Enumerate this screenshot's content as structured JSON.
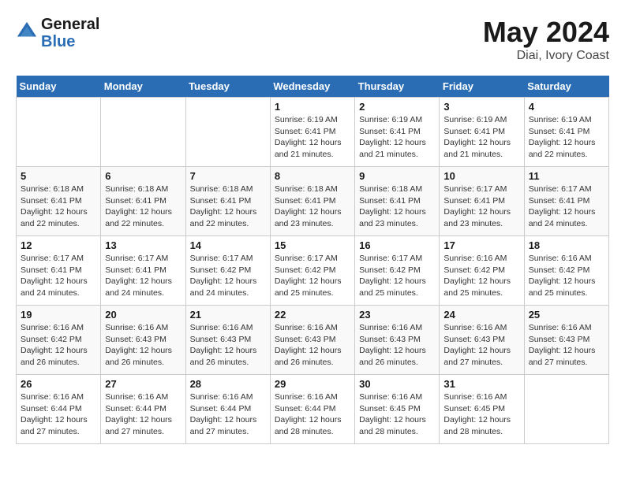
{
  "header": {
    "logo_line1": "General",
    "logo_line2": "Blue",
    "month": "May 2024",
    "location": "Diai, Ivory Coast"
  },
  "weekdays": [
    "Sunday",
    "Monday",
    "Tuesday",
    "Wednesday",
    "Thursday",
    "Friday",
    "Saturday"
  ],
  "weeks": [
    [
      {
        "day": "",
        "info": ""
      },
      {
        "day": "",
        "info": ""
      },
      {
        "day": "",
        "info": ""
      },
      {
        "day": "1",
        "info": "Sunrise: 6:19 AM\nSunset: 6:41 PM\nDaylight: 12 hours\nand 21 minutes."
      },
      {
        "day": "2",
        "info": "Sunrise: 6:19 AM\nSunset: 6:41 PM\nDaylight: 12 hours\nand 21 minutes."
      },
      {
        "day": "3",
        "info": "Sunrise: 6:19 AM\nSunset: 6:41 PM\nDaylight: 12 hours\nand 21 minutes."
      },
      {
        "day": "4",
        "info": "Sunrise: 6:19 AM\nSunset: 6:41 PM\nDaylight: 12 hours\nand 22 minutes."
      }
    ],
    [
      {
        "day": "5",
        "info": "Sunrise: 6:18 AM\nSunset: 6:41 PM\nDaylight: 12 hours\nand 22 minutes."
      },
      {
        "day": "6",
        "info": "Sunrise: 6:18 AM\nSunset: 6:41 PM\nDaylight: 12 hours\nand 22 minutes."
      },
      {
        "day": "7",
        "info": "Sunrise: 6:18 AM\nSunset: 6:41 PM\nDaylight: 12 hours\nand 22 minutes."
      },
      {
        "day": "8",
        "info": "Sunrise: 6:18 AM\nSunset: 6:41 PM\nDaylight: 12 hours\nand 23 minutes."
      },
      {
        "day": "9",
        "info": "Sunrise: 6:18 AM\nSunset: 6:41 PM\nDaylight: 12 hours\nand 23 minutes."
      },
      {
        "day": "10",
        "info": "Sunrise: 6:17 AM\nSunset: 6:41 PM\nDaylight: 12 hours\nand 23 minutes."
      },
      {
        "day": "11",
        "info": "Sunrise: 6:17 AM\nSunset: 6:41 PM\nDaylight: 12 hours\nand 24 minutes."
      }
    ],
    [
      {
        "day": "12",
        "info": "Sunrise: 6:17 AM\nSunset: 6:41 PM\nDaylight: 12 hours\nand 24 minutes."
      },
      {
        "day": "13",
        "info": "Sunrise: 6:17 AM\nSunset: 6:41 PM\nDaylight: 12 hours\nand 24 minutes."
      },
      {
        "day": "14",
        "info": "Sunrise: 6:17 AM\nSunset: 6:42 PM\nDaylight: 12 hours\nand 24 minutes."
      },
      {
        "day": "15",
        "info": "Sunrise: 6:17 AM\nSunset: 6:42 PM\nDaylight: 12 hours\nand 25 minutes."
      },
      {
        "day": "16",
        "info": "Sunrise: 6:17 AM\nSunset: 6:42 PM\nDaylight: 12 hours\nand 25 minutes."
      },
      {
        "day": "17",
        "info": "Sunrise: 6:16 AM\nSunset: 6:42 PM\nDaylight: 12 hours\nand 25 minutes."
      },
      {
        "day": "18",
        "info": "Sunrise: 6:16 AM\nSunset: 6:42 PM\nDaylight: 12 hours\nand 25 minutes."
      }
    ],
    [
      {
        "day": "19",
        "info": "Sunrise: 6:16 AM\nSunset: 6:42 PM\nDaylight: 12 hours\nand 26 minutes."
      },
      {
        "day": "20",
        "info": "Sunrise: 6:16 AM\nSunset: 6:43 PM\nDaylight: 12 hours\nand 26 minutes."
      },
      {
        "day": "21",
        "info": "Sunrise: 6:16 AM\nSunset: 6:43 PM\nDaylight: 12 hours\nand 26 minutes."
      },
      {
        "day": "22",
        "info": "Sunrise: 6:16 AM\nSunset: 6:43 PM\nDaylight: 12 hours\nand 26 minutes."
      },
      {
        "day": "23",
        "info": "Sunrise: 6:16 AM\nSunset: 6:43 PM\nDaylight: 12 hours\nand 26 minutes."
      },
      {
        "day": "24",
        "info": "Sunrise: 6:16 AM\nSunset: 6:43 PM\nDaylight: 12 hours\nand 27 minutes."
      },
      {
        "day": "25",
        "info": "Sunrise: 6:16 AM\nSunset: 6:43 PM\nDaylight: 12 hours\nand 27 minutes."
      }
    ],
    [
      {
        "day": "26",
        "info": "Sunrise: 6:16 AM\nSunset: 6:44 PM\nDaylight: 12 hours\nand 27 minutes."
      },
      {
        "day": "27",
        "info": "Sunrise: 6:16 AM\nSunset: 6:44 PM\nDaylight: 12 hours\nand 27 minutes."
      },
      {
        "day": "28",
        "info": "Sunrise: 6:16 AM\nSunset: 6:44 PM\nDaylight: 12 hours\nand 27 minutes."
      },
      {
        "day": "29",
        "info": "Sunrise: 6:16 AM\nSunset: 6:44 PM\nDaylight: 12 hours\nand 28 minutes."
      },
      {
        "day": "30",
        "info": "Sunrise: 6:16 AM\nSunset: 6:45 PM\nDaylight: 12 hours\nand 28 minutes."
      },
      {
        "day": "31",
        "info": "Sunrise: 6:16 AM\nSunset: 6:45 PM\nDaylight: 12 hours\nand 28 minutes."
      },
      {
        "day": "",
        "info": ""
      }
    ]
  ]
}
